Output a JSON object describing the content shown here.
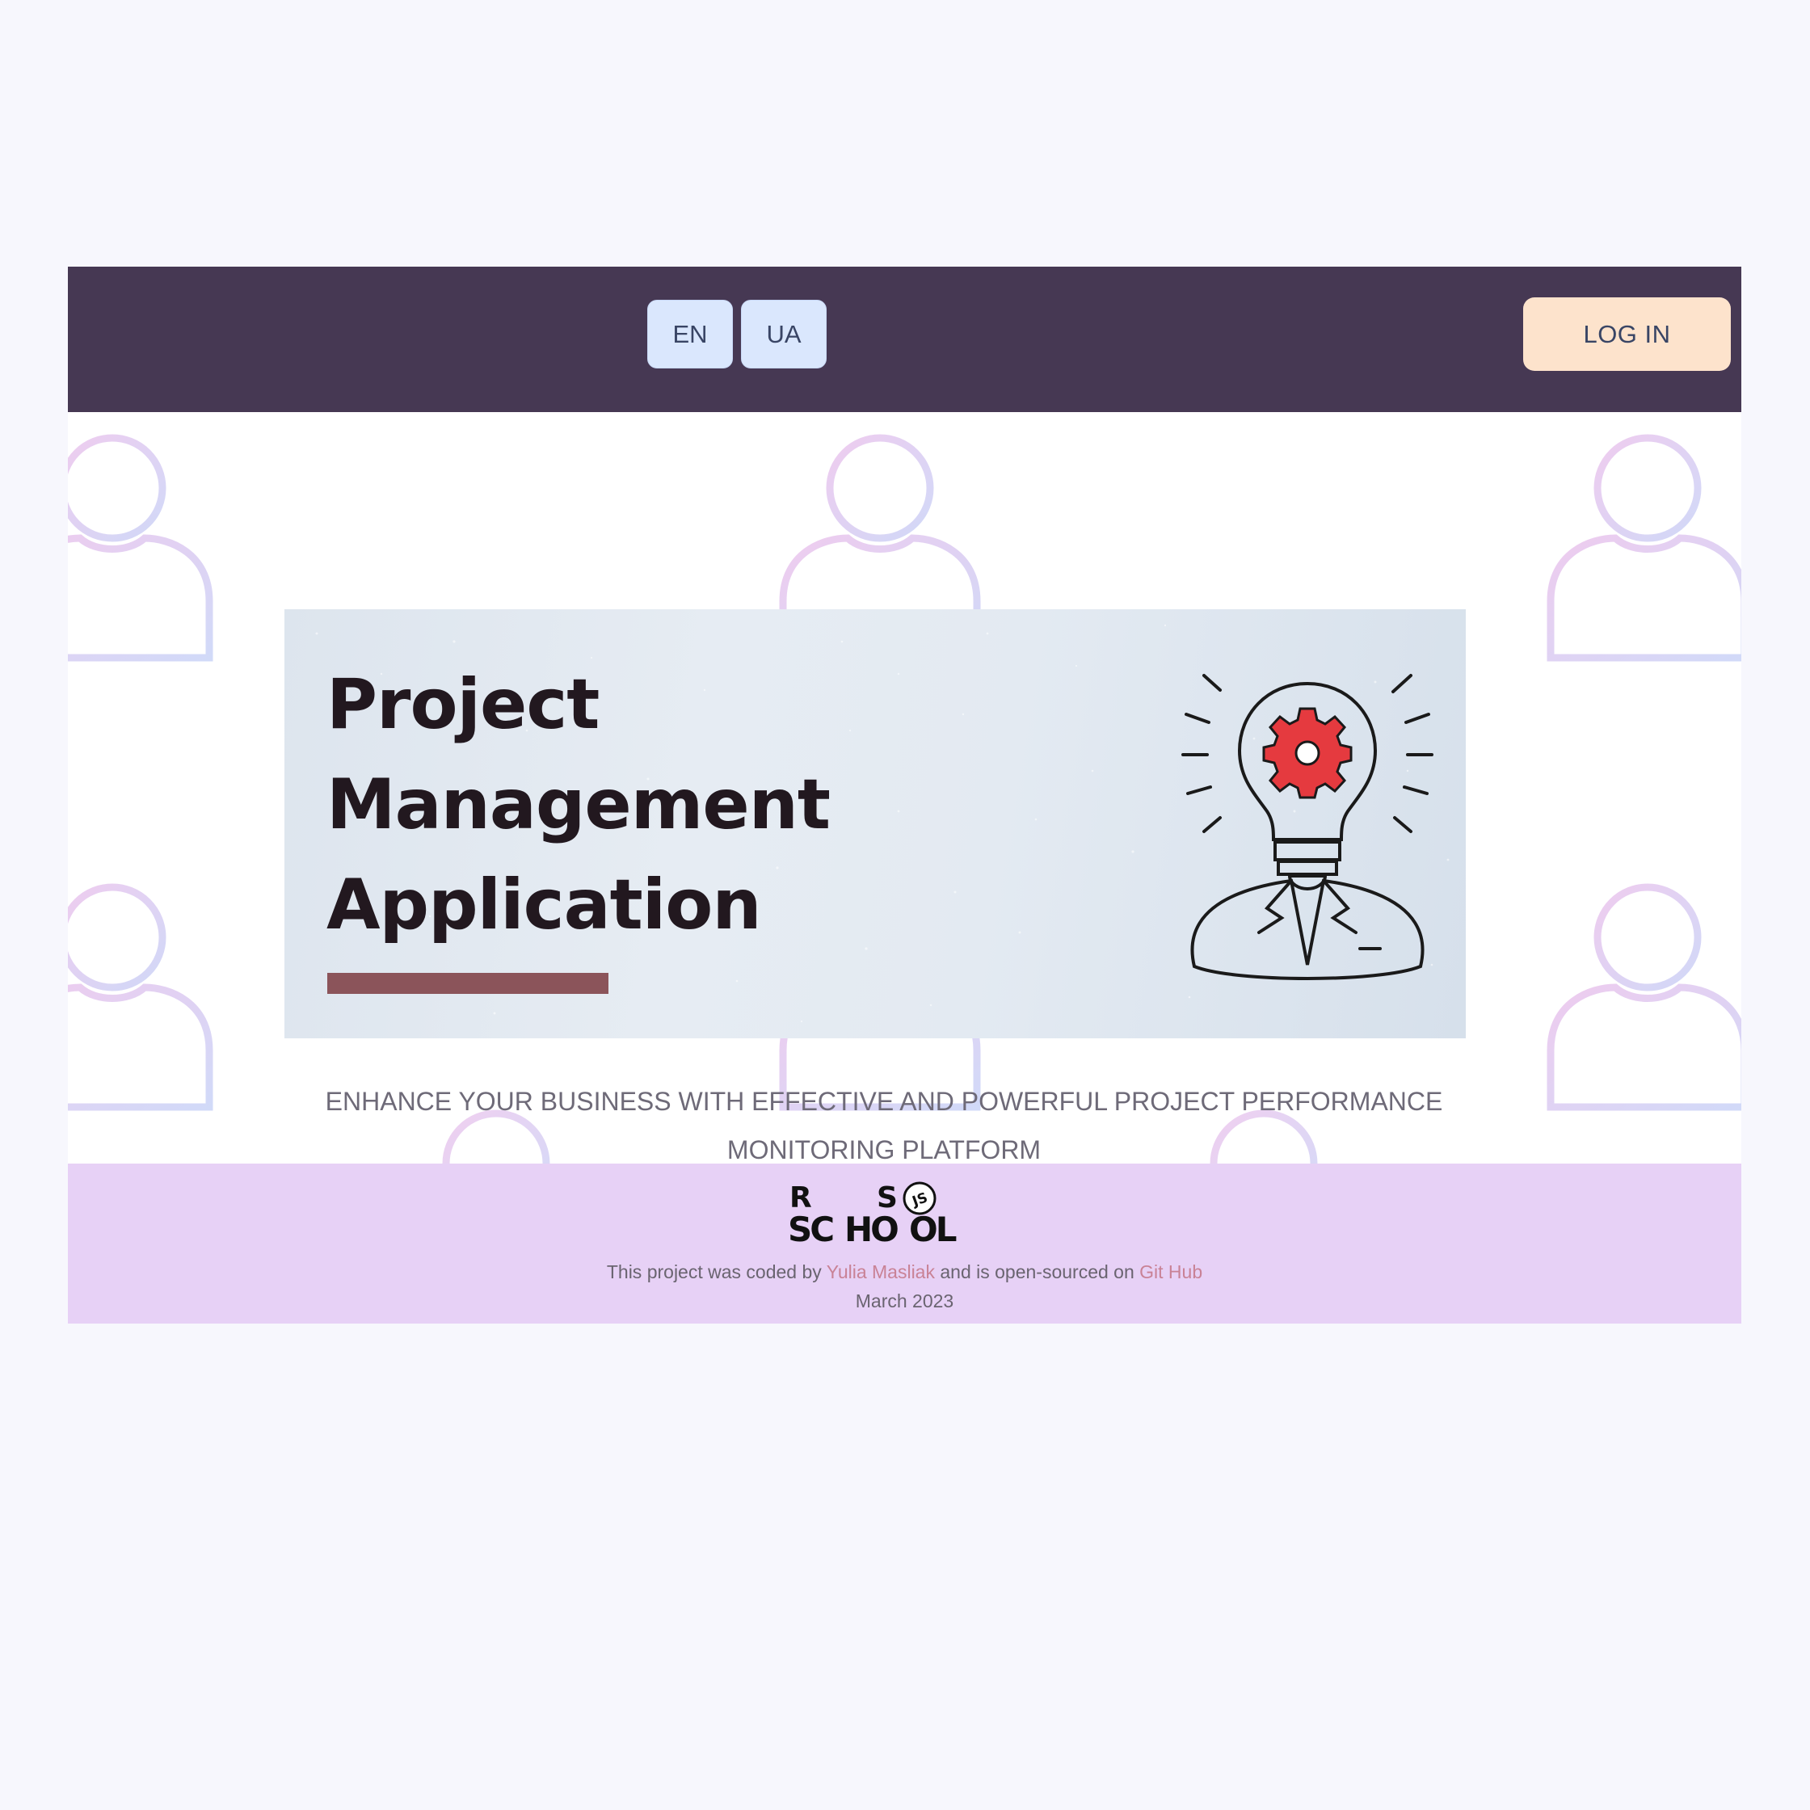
{
  "header": {
    "languages": [
      "EN",
      "UA"
    ],
    "login_label": "LOG IN"
  },
  "hero": {
    "title_lines": [
      "Project",
      "Management",
      "Application"
    ],
    "accent_color": "#8b545a",
    "illustration": "lightbulb-gear-person-icon"
  },
  "tagline": "ENHANCE YOUR BUSINESS WITH EFFECTIVE AND POWERFUL PROJECT PERFORMANCE MONITORING PLATFORM",
  "footer": {
    "logo": {
      "name": "rs-school-logo",
      "text": "RS SCHOOL JS"
    },
    "credit_prefix": "This project was coded by",
    "author": "Yulia Masliak",
    "credit_middle": "and is open-sourced on",
    "repo_link": "Git Hub",
    "date": "March 2023"
  },
  "colors": {
    "page_background": "#f7f7fd",
    "header_background": "#463853",
    "lang_button": "#dae7fd",
    "login_button": "#fde3cc",
    "footer_background": "#e7d1f6",
    "link": "#c98296"
  }
}
